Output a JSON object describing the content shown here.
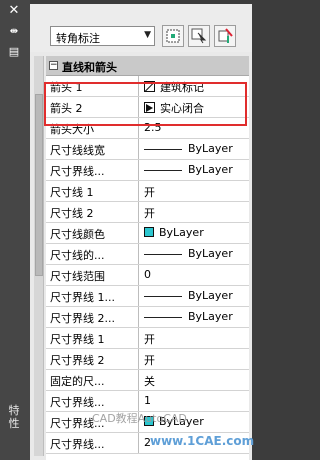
{
  "window": {
    "close_icon": "✕",
    "auto_hide_icon": "⇹",
    "menu_icon": "▤",
    "title": "特性"
  },
  "toolbar": {
    "selected_object": "转角标注",
    "buttons": [
      "quick-select-icon",
      "select-objects-icon",
      "toggle-pickadd-icon"
    ]
  },
  "section": {
    "title": "直线和箭头",
    "toggle": "−"
  },
  "properties": [
    {
      "name": "箭头 1",
      "value": "建筑标记",
      "icon": "oblique"
    },
    {
      "name": "箭头 2",
      "value": "实心闭合",
      "icon": "closed"
    },
    {
      "name": "箭头大小",
      "value": "2.5"
    },
    {
      "name": "尺寸线线宽",
      "value": "ByLayer",
      "line": true
    },
    {
      "name": "尺寸界线...",
      "value": "ByLayer",
      "line": true
    },
    {
      "name": "尺寸线 1",
      "value": "开"
    },
    {
      "name": "尺寸线 2",
      "value": "开"
    },
    {
      "name": "尺寸线颜色",
      "value": "ByLayer",
      "swatch": true
    },
    {
      "name": "尺寸线的...",
      "value": "ByLayer",
      "line": true
    },
    {
      "name": "尺寸线范围",
      "value": "0"
    },
    {
      "name": "尺寸界线 1...",
      "value": "ByLayer",
      "line": true
    },
    {
      "name": "尺寸界线 2...",
      "value": "ByLayer",
      "line": true
    },
    {
      "name": "尺寸界线 1",
      "value": "开"
    },
    {
      "name": "尺寸界线 2",
      "value": "开"
    },
    {
      "name": "固定的尺...",
      "value": "关"
    },
    {
      "name": "尺寸界线...",
      "value": "1"
    },
    {
      "name": "尺寸界线...",
      "value": "ByLayer",
      "swatch": true
    },
    {
      "name": "尺寸界线...",
      "value": "2"
    }
  ],
  "watermark": {
    "text": "CAD教程AutoCAD",
    "site": "www.1CAE.com"
  },
  "colors": {
    "highlight": "#e02d2d",
    "bylayer_swatch": "#2cc6cf"
  }
}
